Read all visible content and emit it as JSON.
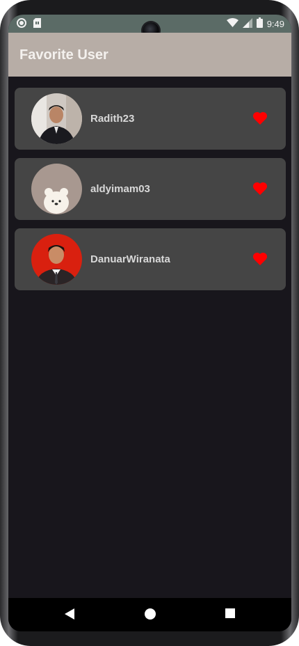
{
  "status_bar": {
    "time": "9:49",
    "icons": [
      "record-icon",
      "sim-card-icon",
      "wifi-icon",
      "signal-icon",
      "battery-icon"
    ]
  },
  "app_bar": {
    "title": "Favorite User"
  },
  "favorites": [
    {
      "username": "Radith23",
      "favorite_icon": "heart-icon",
      "favorite_color": "#ff0000"
    },
    {
      "username": "aldyimam03",
      "favorite_icon": "heart-icon",
      "favorite_color": "#ff0000"
    },
    {
      "username": "DanuarWiranata",
      "favorite_icon": "heart-icon",
      "favorite_color": "#ff0000"
    }
  ],
  "nav_bar": {
    "icons": [
      "back-icon",
      "home-icon",
      "recents-icon"
    ]
  },
  "colors": {
    "app_bar": "#b7ada6",
    "background": "#18161c",
    "card": "#454545",
    "heart": "#ff0000"
  }
}
